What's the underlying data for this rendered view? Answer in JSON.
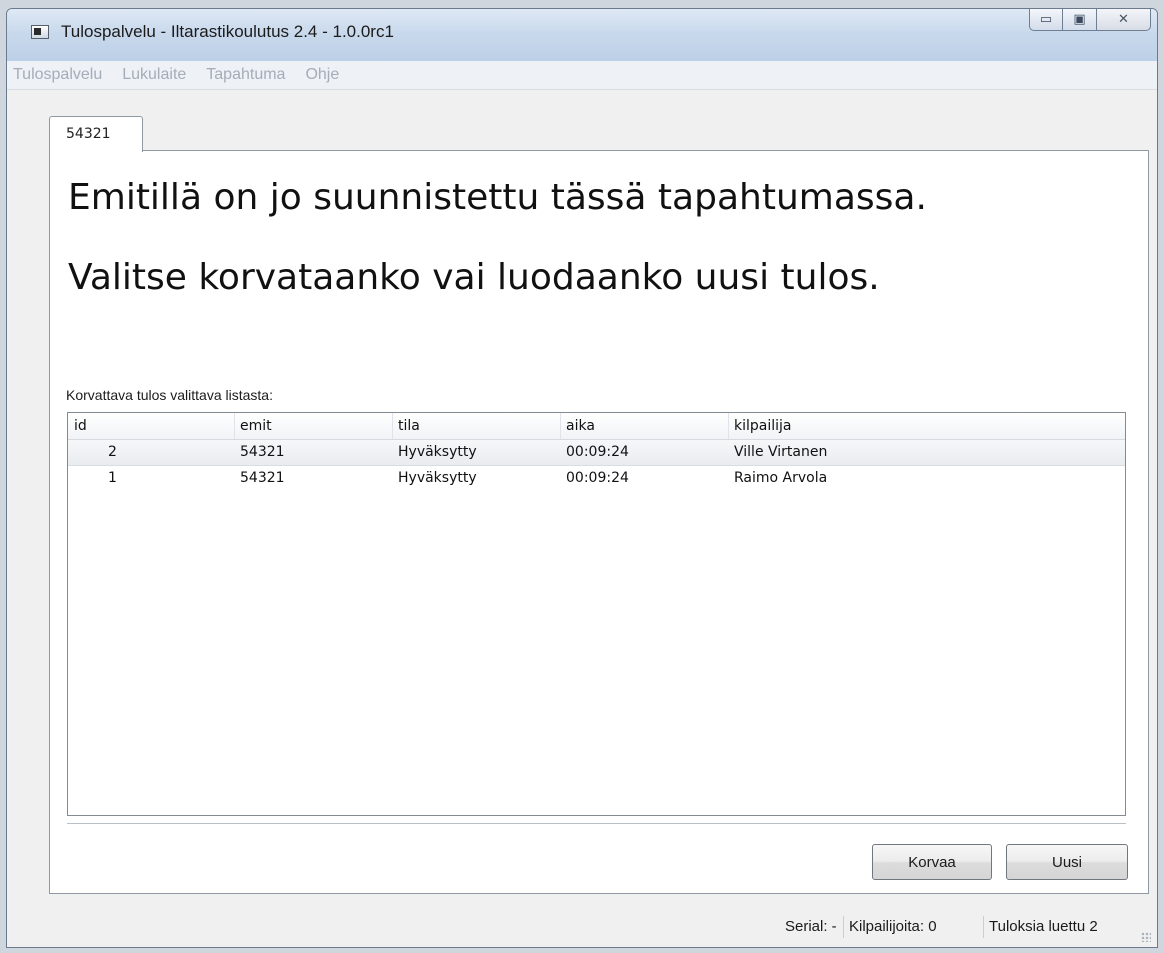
{
  "window": {
    "title": "Tulospalvelu - Iltarastikoulutus 2.4 - 1.0.0rc1",
    "controls": {
      "minimize": "▭",
      "maximize": "▣",
      "close": "✕"
    }
  },
  "menubar": {
    "items": [
      "Tulospalvelu",
      "Lukulaite",
      "Tapahtuma",
      "Ohje"
    ]
  },
  "tab": {
    "label": "54321"
  },
  "message": {
    "line1": "Emitillä on jo suunnistettu tässä tapahtumassa.",
    "line2": "Valitse korvataanko vai luodaanko uusi tulos."
  },
  "list_label": "Korvattava tulos valittava listasta:",
  "table": {
    "columns": [
      "id",
      "emit",
      "tila",
      "aika",
      "kilpailija"
    ],
    "rows": [
      {
        "id": "2",
        "emit": "54321",
        "tila": "Hyväksytty",
        "aika": "00:09:24",
        "kilpailija": "Ville Virtanen",
        "selected": true
      },
      {
        "id": "1",
        "emit": "54321",
        "tila": "Hyväksytty",
        "aika": "00:09:24",
        "kilpailija": "Raimo Arvola",
        "selected": false
      }
    ]
  },
  "buttons": {
    "replace": "Korvaa",
    "new": "Uusi"
  },
  "statusbar": {
    "serial": "Serial: -",
    "competitors": "Kilpailijoita: 0",
    "results_read": "Tuloksia luettu 2"
  },
  "colors": {
    "titlebar": "#c9d9ec",
    "menu_text_disabled": "#a4adb8",
    "selected_row": "#e9ecf0"
  }
}
